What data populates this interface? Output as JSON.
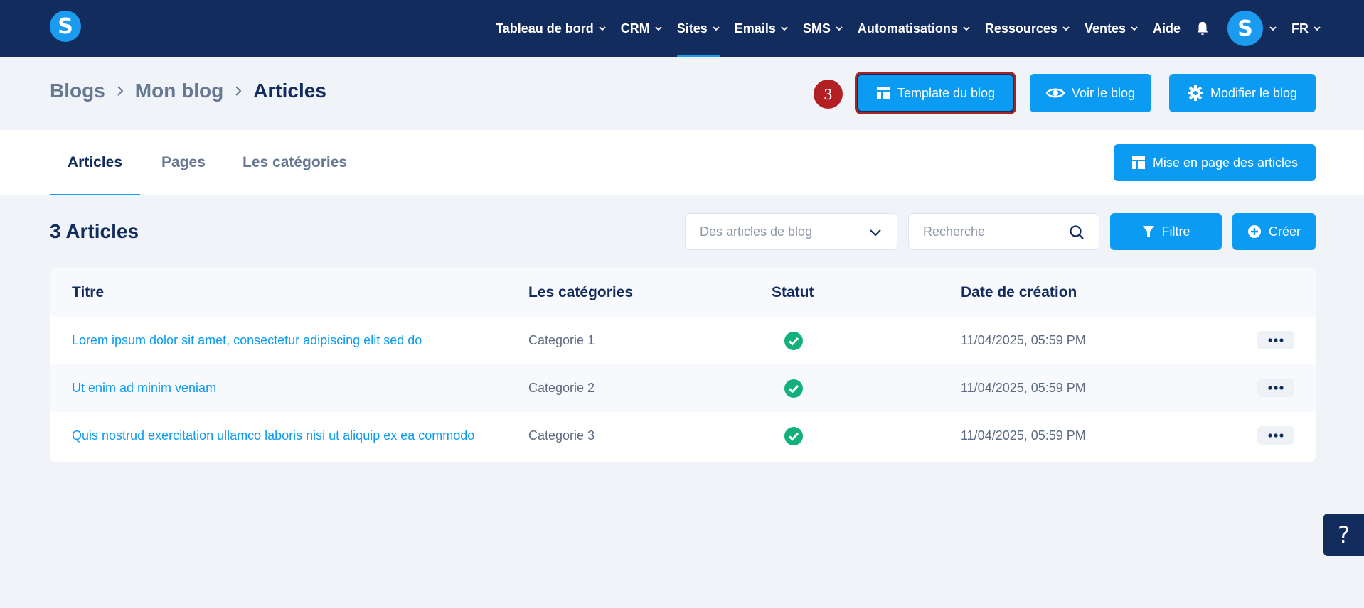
{
  "app": {
    "logo_letter": "S",
    "avatar_letter": "S"
  },
  "nav": {
    "items": [
      {
        "label": "Tableau de bord",
        "has_menu": true,
        "active": false
      },
      {
        "label": "CRM",
        "has_menu": true,
        "active": false
      },
      {
        "label": "Sites",
        "has_menu": true,
        "active": true
      },
      {
        "label": "Emails",
        "has_menu": true,
        "active": false
      },
      {
        "label": "SMS",
        "has_menu": true,
        "active": false
      },
      {
        "label": "Automatisations",
        "has_menu": true,
        "active": false
      },
      {
        "label": "Ressources",
        "has_menu": true,
        "active": false
      },
      {
        "label": "Ventes",
        "has_menu": true,
        "active": false
      },
      {
        "label": "Aide",
        "has_menu": false,
        "active": false
      }
    ],
    "language": "FR"
  },
  "breadcrumb": [
    "Blogs",
    "Mon blog",
    "Articles"
  ],
  "step_badge": "3",
  "header_buttons": {
    "template": "Template du blog",
    "view": "Voir le blog",
    "edit": "Modifier le blog"
  },
  "tabs": [
    "Articles",
    "Pages",
    "Les catégories"
  ],
  "layout_button": "Mise en page des articles",
  "section_title": "3 Articles",
  "filters": {
    "select_value": "Des articles de blog",
    "search_placeholder": "Recherche",
    "filter_label": "Filtre",
    "create_label": "Créer"
  },
  "table": {
    "headers": {
      "title": "Titre",
      "categories": "Les catégories",
      "status": "Statut",
      "date": "Date de création"
    },
    "rows": [
      {
        "title": "Lorem ipsum dolor sit amet, consectetur adipiscing elit sed do",
        "category": "Categorie 1",
        "status": "published",
        "date": "11/04/2025, 05:59 PM"
      },
      {
        "title": "Ut enim ad minim veniam",
        "category": "Categorie 2",
        "status": "published",
        "date": "11/04/2025, 05:59 PM"
      },
      {
        "title": "Quis nostrud exercitation ullamco laboris nisi ut aliquip ex ea commodo",
        "category": "Categorie 3",
        "status": "published",
        "date": "11/04/2025, 05:59 PM"
      }
    ]
  },
  "help_label": "?",
  "colors": {
    "navy": "#132c5e",
    "accent": "#0b9bf3",
    "success": "#12b07a",
    "badge": "#b22024"
  }
}
